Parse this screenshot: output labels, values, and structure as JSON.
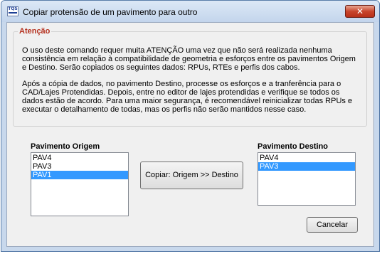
{
  "window": {
    "title": "Copiar protensão de um pavimento para outro",
    "app_icon_text": "TQS",
    "close_glyph": "✕"
  },
  "notice": {
    "legend": "Atenção",
    "paragraph1": "O uso deste comando requer muita ATENÇÃO uma vez que não será realizada nenhuma consistência em relação à compatibilidade de geometria e esforços entre os pavimentos Origem e Destino. Serão copiados os seguintes dados: RPUs, RTEs e perfis dos cabos.",
    "paragraph2": "Após a cópia de dados, no pavimento Destino, processe os esforços e a tranferência para o CAD/Lajes Protendidas. Depois, entre no editor de lajes protendidas e verifique se todos os dados estão de acordo. Para uma maior segurança, é recomendável reinicializar todas RPUs e executar o detalhamento de todas, mas os perfis não serão mantidos nesse caso."
  },
  "origin": {
    "label": "Pavimento Origem",
    "items": [
      {
        "label": "PAV4",
        "selected": false
      },
      {
        "label": "PAV3",
        "selected": false
      },
      {
        "label": "PAV1",
        "selected": true
      }
    ]
  },
  "destination": {
    "label": "Pavimento Destino",
    "items": [
      {
        "label": "PAV4",
        "selected": false
      },
      {
        "label": "PAV3",
        "selected": true
      }
    ]
  },
  "buttons": {
    "copy": "Copiar: Origem >> Destino",
    "cancel": "Cancelar"
  },
  "colors": {
    "accent_heading": "#b4301e",
    "selection": "#3399ff",
    "close_button": "#c8452c"
  }
}
